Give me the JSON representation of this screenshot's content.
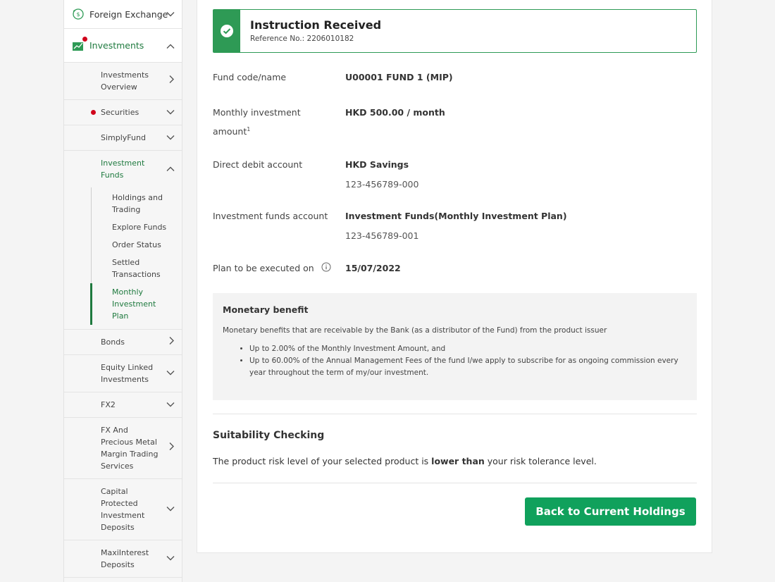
{
  "sidebar": {
    "foreign_exchange": "Foreign Exchange",
    "investments": "Investments",
    "sub": {
      "investments_overview": "Investments Overview",
      "securities": "Securities",
      "simplyfund": "SimplyFund",
      "investment_funds": "Investment Funds",
      "bonds": "Bonds",
      "equity_linked": "Equity Linked Investments",
      "fx2": "FX2",
      "fx_precious": "FX And Precious Metal Margin Trading Services",
      "capital_protected": "Capital Protected Investment Deposits",
      "maxiinterest": "MaxiInterest Deposits"
    },
    "funds_menu": {
      "holdings": "Holdings and Trading",
      "explore": "Explore Funds",
      "order_status": "Order Status",
      "settled": "Settled Transactions",
      "monthly": "Monthly Investment Plan"
    }
  },
  "banner": {
    "title": "Instruction Received",
    "reference": "Reference No.: 2206010182"
  },
  "details": {
    "fund_label": "Fund code/name",
    "fund_value": "U00001 FUND 1 (MIP)",
    "amount_label": "Monthly investment amount",
    "amount_sup": "1",
    "amount_value": "HKD 500.00 / month",
    "debit_label": "Direct debit account",
    "debit_name": "HKD Savings",
    "debit_number": "123-456789-000",
    "funds_account_label": "Investment funds account",
    "funds_account_name": "Investment Funds(Monthly Investment Plan)",
    "funds_account_number": "123-456789-001",
    "plan_label": "Plan to be executed on",
    "plan_date": "15/07/2022"
  },
  "benefit": {
    "heading": "Monetary benefit",
    "intro": "Monetary benefits that are receivable by the Bank (as a distributor of the Fund) from the product issuer",
    "items": [
      "Up to 2.00% of the Monthly Investment Amount, and",
      "Up to 60.00% of the Annual Management Fees of the fund I/we apply to subscribe for as ongoing commission every year throughout the term of my/our investment."
    ]
  },
  "suitability": {
    "title": "Suitability Checking",
    "text_before": "The product risk level of your selected product is ",
    "text_bold": "lower than",
    "text_after": " your risk tolerance level."
  },
  "back_button": "Back to Current Holdings",
  "colors": {
    "accent_green": "#2e9a55",
    "button_green": "#10a15c",
    "alert_red": "#d0021b"
  }
}
